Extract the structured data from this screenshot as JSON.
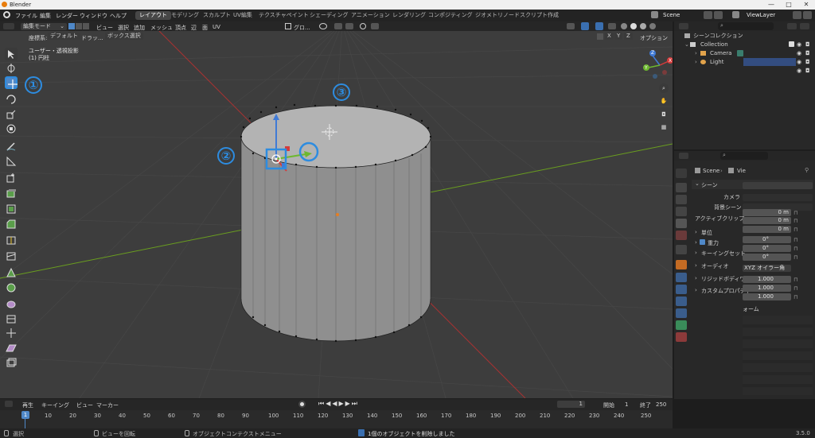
{
  "titlebar": {
    "title": "Blender",
    "minimize": "—",
    "maximize": "□",
    "close": "✕"
  },
  "menus": [
    "ファイル",
    "編集",
    "レンダー",
    "ウィンドウ",
    "ヘルプ"
  ],
  "workspace_tabs": [
    {
      "label": "レイアウト",
      "active": true
    },
    {
      "label": "モデリング"
    },
    {
      "label": "スカルプト"
    },
    {
      "label": "UV編集"
    },
    {
      "label": "テクスチャペイント"
    },
    {
      "label": "シェーディング"
    },
    {
      "label": "アニメーション"
    },
    {
      "label": "レンダリング"
    },
    {
      "label": "コンポジティング"
    },
    {
      "label": "ジオメトリノード"
    },
    {
      "label": "スクリプト作成"
    }
  ],
  "scene_selector": "Scene",
  "viewlayer_selector": "ViewLayer",
  "viewport_header": {
    "mode": "編集モード",
    "menus": [
      "ビュー",
      "選択",
      "追加",
      "メッシュ",
      "頂点",
      "辺",
      "面",
      "UV"
    ],
    "transform_orientation": "グロ...",
    "options": "オプション"
  },
  "tool_header": {
    "coords_label": "座標系:",
    "coords_value": "デフォルト",
    "drag_label": "ドラッ...",
    "drag_value": "ボックス選択",
    "axes": [
      "X",
      "Y",
      "Z"
    ]
  },
  "viewport": {
    "view_name": "ユーザー・透視投影",
    "object_name": "(1) 円柱"
  },
  "annotations": [
    "①",
    "②",
    "③"
  ],
  "gizmo_axes": [
    "X",
    "Y",
    "Z"
  ],
  "outliner": {
    "header": "シーンコレクション",
    "collection": "Collection",
    "items": [
      "Camera",
      "Light"
    ]
  },
  "properties": {
    "breadcrumb_scene": "Scene",
    "breadcrumb_viewlayer": "Vie",
    "panel_title": "シーン",
    "fields": [
      {
        "label": "カメラ",
        "value": ""
      },
      {
        "label": "背景シーン",
        "value": ""
      },
      {
        "label": "アクティブクリップ",
        "value": "0 m"
      }
    ],
    "unit_values": [
      "0 m",
      "0 m",
      "0 m"
    ],
    "sections": [
      {
        "label": "単位",
        "value": "0°"
      },
      {
        "label": "重力",
        "value": "0°",
        "checked": true
      },
      {
        "label": "キーイングセット",
        "value": "0°"
      },
      {
        "label": "オーディオ",
        "value": "XYZ オイラー角"
      },
      {
        "label": "リジッドボディワール",
        "value": "1.000"
      },
      {
        "label": "カスタムプロパティ",
        "value": "1.000"
      }
    ],
    "extra_value": "1.000",
    "extra_label": "ォーム"
  },
  "timeline": {
    "playback": "再生",
    "keying": "キーイング",
    "view": "ビュー",
    "marker": "マーカー",
    "current_frame": "1",
    "start_label": "開始",
    "start": "1",
    "end_label": "終了",
    "end": "250",
    "ticks": [
      "1",
      "10",
      "20",
      "30",
      "40",
      "50",
      "60",
      "70",
      "80",
      "90",
      "100",
      "110",
      "120",
      "130",
      "140",
      "150",
      "160",
      "170",
      "180",
      "190",
      "200",
      "210",
      "220",
      "230",
      "240",
      "250"
    ]
  },
  "statusbar": {
    "select": "選択",
    "rotate": "ビューを回転",
    "context": "オブジェクトコンテクストメニュー",
    "message": "1個のオブジェクトを削除しました",
    "version": "3.5.0"
  },
  "colors": {
    "accent": "#4f88c8",
    "annotation": "#2d8ce0",
    "x_axis": "#c0392b",
    "y_axis": "#6a9e1f"
  }
}
